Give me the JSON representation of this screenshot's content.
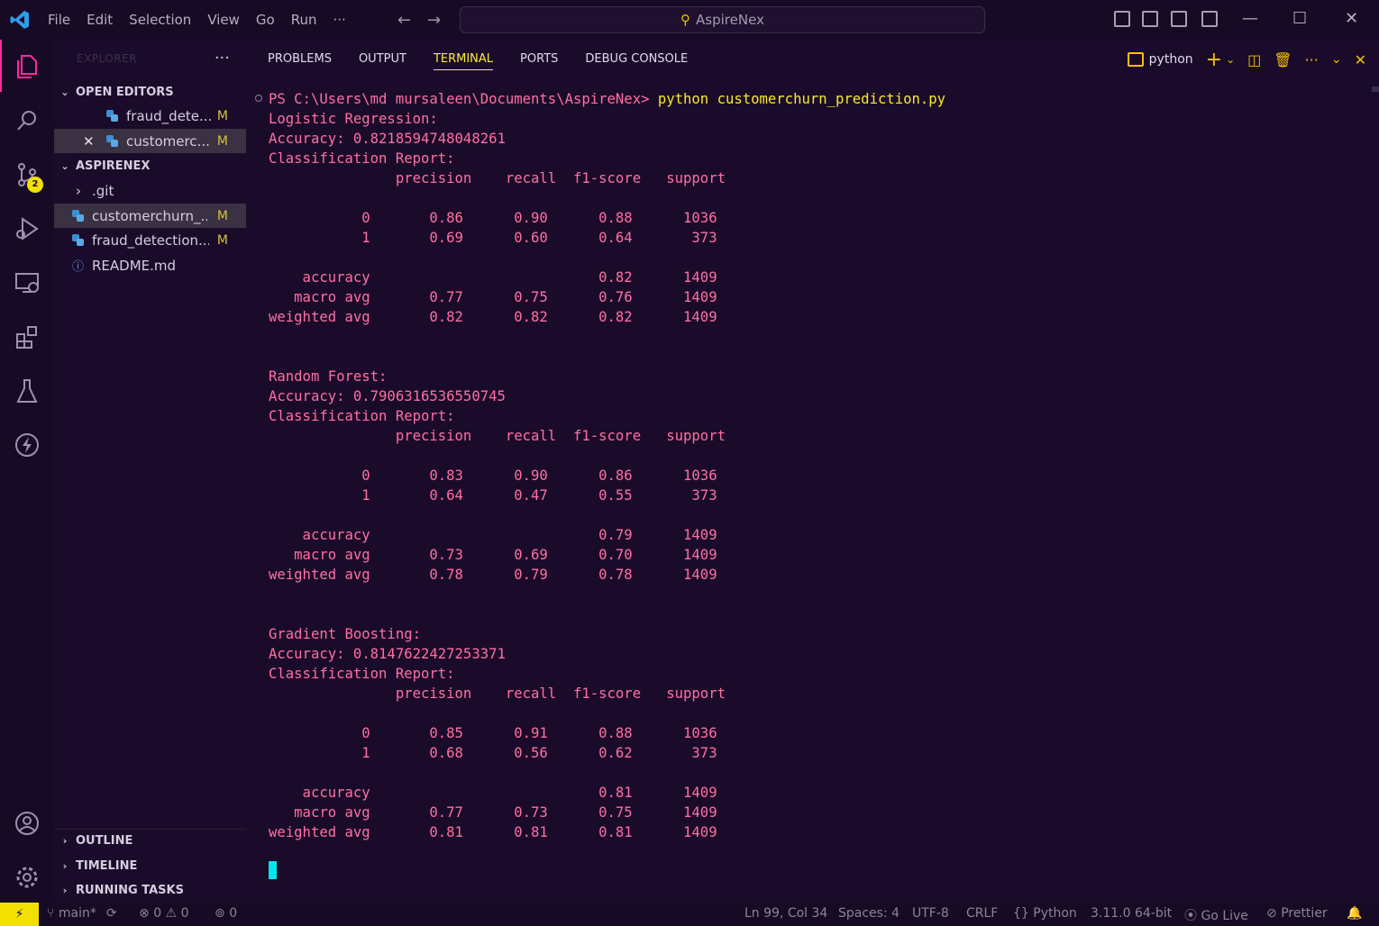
{
  "titlebar": {
    "menu": [
      "File",
      "Edit",
      "Selection",
      "View",
      "Go",
      "Run",
      "···"
    ],
    "search_text": "AspireNex"
  },
  "activity_bar": {
    "source_control_badge": "2"
  },
  "sidebar": {
    "title": "EXPLORER",
    "open_editors_label": "OPEN EDITORS",
    "open_editors": [
      {
        "name": "fraud_dete...",
        "status": "M"
      },
      {
        "name": "customerc...",
        "status": "M"
      }
    ],
    "folder_label": "ASPIRENEX",
    "files": [
      {
        "name": ".git"
      },
      {
        "name": "customerchurn_...",
        "status": "M"
      },
      {
        "name": "fraud_detection....",
        "status": "M"
      },
      {
        "name": "README.md"
      }
    ],
    "outline_label": "OUTLINE",
    "timeline_label": "TIMELINE",
    "running_tasks_label": "RUNNING TASKS"
  },
  "panel": {
    "tabs": [
      "PROBLEMS",
      "OUTPUT",
      "TERMINAL",
      "PORTS",
      "DEBUG CONSOLE"
    ],
    "active_tab": "TERMINAL",
    "terminal_name": "python"
  },
  "terminal": {
    "prompt": "PS C:\\Users\\md mursaleen\\Documents\\AspireNex> ",
    "command": "python customerchurn_prediction.py",
    "output": "Logistic Regression:\nAccuracy: 0.8218594748048261\nClassification Report:\n               precision    recall  f1-score   support\n\n           0       0.86      0.90      0.88      1036\n           1       0.69      0.60      0.64       373\n\n    accuracy                           0.82      1409\n   macro avg       0.77      0.75      0.76      1409\nweighted avg       0.82      0.82      0.82      1409\n\n\nRandom Forest:\nAccuracy: 0.7906316536550745\nClassification Report:\n               precision    recall  f1-score   support\n\n           0       0.83      0.90      0.86      1036\n           1       0.64      0.47      0.55       373\n\n    accuracy                           0.79      1409\n   macro avg       0.73      0.69      0.70      1409\nweighted avg       0.78      0.79      0.78      1409\n\n\nGradient Boosting:\nAccuracy: 0.8147622427253371\nClassification Report:\n               precision    recall  f1-score   support\n\n           0       0.85      0.91      0.88      1036\n           1       0.68      0.56      0.62       373\n\n    accuracy                           0.81      1409\n   macro avg       0.77      0.73      0.75      1409\nweighted avg       0.81      0.81      0.81      1409"
  },
  "statusbar": {
    "branch": "main*",
    "errors": "0",
    "warnings": "0",
    "ports": "0",
    "position": "Ln 99, Col 34",
    "spaces": "Spaces: 4",
    "encoding": "UTF-8",
    "eol": "CRLF",
    "language": "Python",
    "interpreter": "3.11.0 64-bit",
    "go_live": "Go Live",
    "prettier": "Prettier"
  },
  "colors": {
    "accent": "#f2e100",
    "terminal_text": "#ff6fa3",
    "command_text": "#f8e92d",
    "cursor": "#00e5ea",
    "background": "#1b0b2a"
  }
}
